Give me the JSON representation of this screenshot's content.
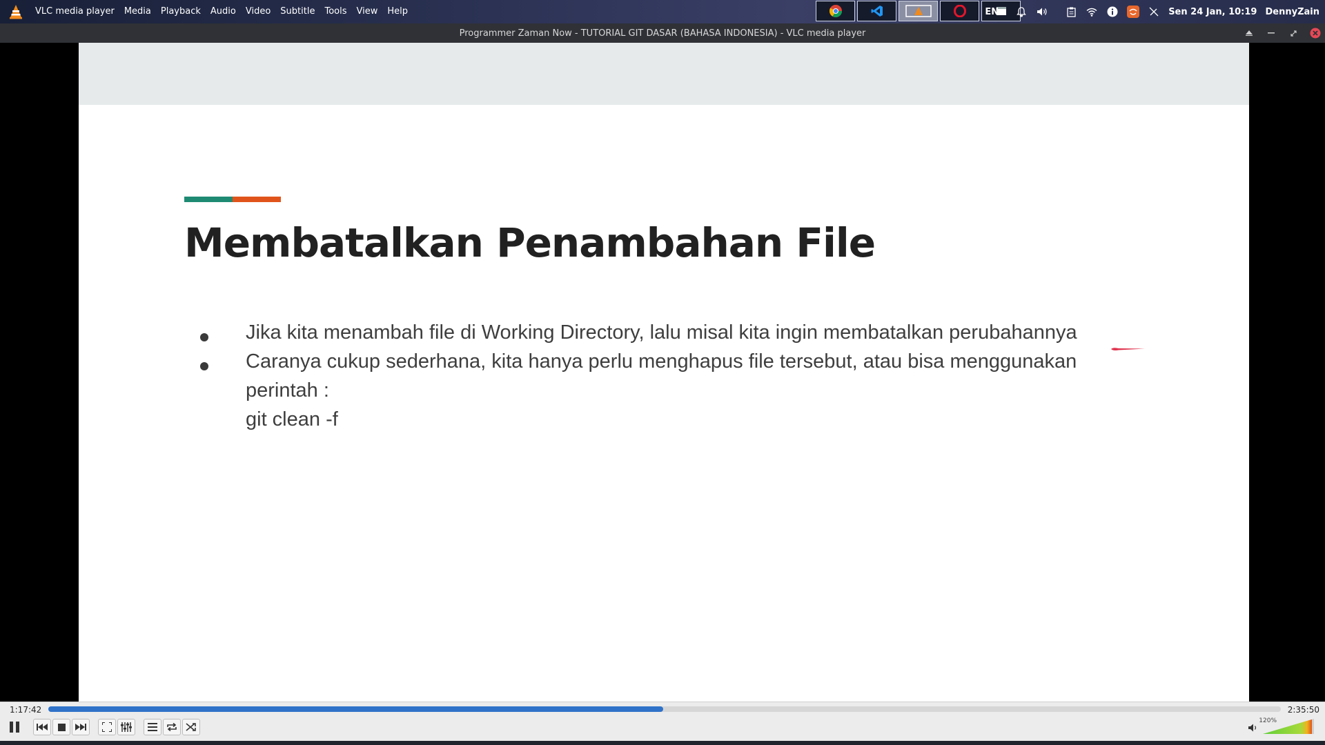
{
  "topbar": {
    "app_name": "VLC media player",
    "menus": [
      "Media",
      "Playback",
      "Audio",
      "Video",
      "Subtitle",
      "Tools",
      "View",
      "Help"
    ],
    "taskbar_icons": [
      "chrome-icon",
      "vscode-icon",
      "vlc-icon",
      "opera-icon",
      "window-icon"
    ],
    "language": "EN",
    "datetime": "Sen 24 Jan, 10:19",
    "user": "DennyZain"
  },
  "window": {
    "title": "Programmer Zaman Now - TUTORIAL GIT DASAR (BAHASA INDONESIA) - VLC media player"
  },
  "slide": {
    "title": "Membatalkan Penambahan File",
    "bullets": [
      {
        "lines": [
          "Jika kita menambah  file di Working Directory, lalu misal kita ingin membatalkan perubahannya"
        ]
      },
      {
        "lines": [
          "Caranya cukup sederhana, kita hanya perlu menghapus file tersebut, atau bisa menggunakan",
          "perintah :",
          "git clean -f"
        ]
      }
    ],
    "colors": {
      "accent_green": "#1f8a73",
      "accent_orange": "#e0541b",
      "pen": "#e0334e"
    }
  },
  "player": {
    "time_elapsed": "1:17:42",
    "time_total": "2:35:50",
    "progress": 0.499,
    "volume_label": "120%",
    "volume_level": 1.2,
    "accent": "#2f72c9"
  }
}
